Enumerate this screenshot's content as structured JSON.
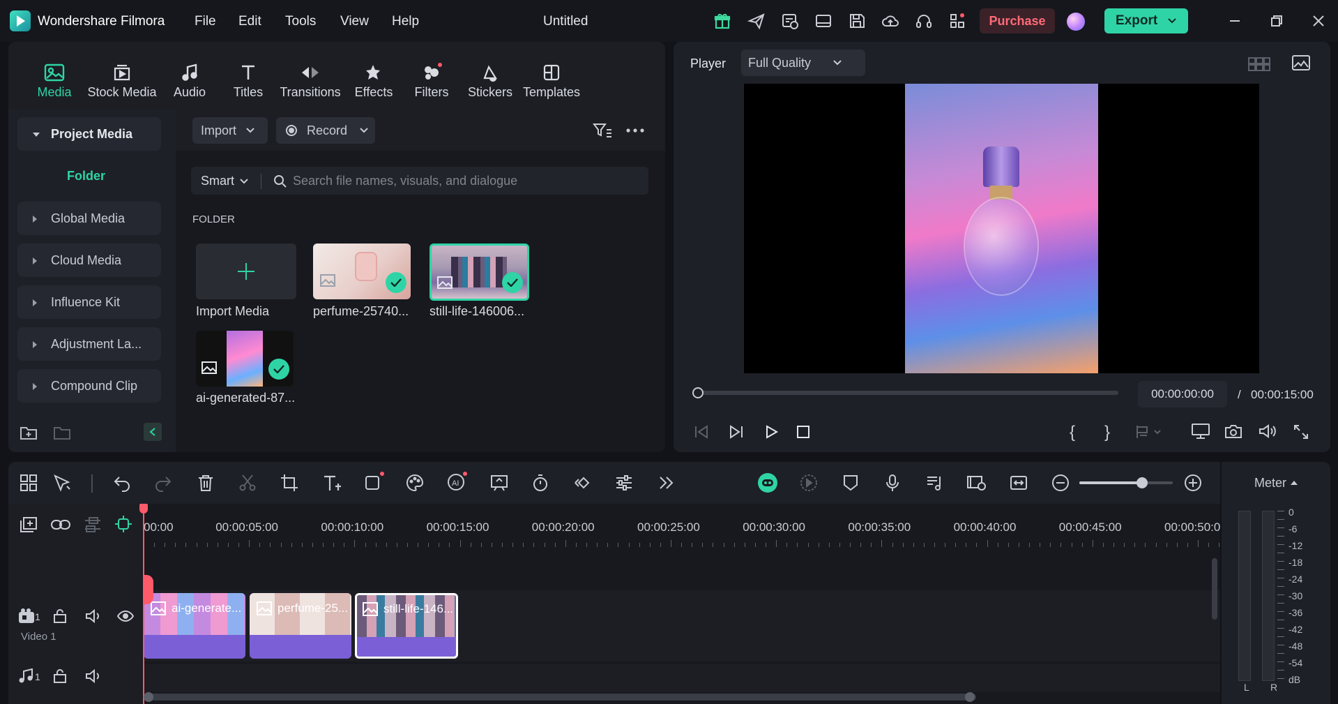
{
  "app": {
    "name": "Wondershare Filmora",
    "doc_title": "Untitled",
    "purchase": "Purchase",
    "export": "Export"
  },
  "menu": [
    "File",
    "Edit",
    "Tools",
    "View",
    "Help"
  ],
  "tabs": [
    "Media",
    "Stock Media",
    "Audio",
    "Titles",
    "Transitions",
    "Effects",
    "Filters",
    "Stickers",
    "Templates"
  ],
  "sidebar": {
    "project_media": "Project Media",
    "folder": "Folder",
    "items": [
      "Global Media",
      "Cloud Media",
      "Influence Kit",
      "Adjustment La...",
      "Compound Clip"
    ]
  },
  "media": {
    "import": "Import",
    "record": "Record",
    "smart": "Smart",
    "search_placeholder": "Search file names, visuals, and dialogue",
    "folder_label": "FOLDER",
    "items": [
      "Import Media",
      "perfume-25740...",
      "still-life-146006...",
      "ai-generated-87..."
    ]
  },
  "player": {
    "label": "Player",
    "quality": "Full Quality",
    "current_time": "00:00:00:00",
    "separator": "/",
    "total_time": "00:00:15:00",
    "progress": 0
  },
  "timeline": {
    "ruler": [
      "00:00",
      "00:00:05:00",
      "00:00:10:00",
      "00:00:15:00",
      "00:00:20:00",
      "00:00:25:00",
      "00:00:30:00",
      "00:00:35:00",
      "00:00:40:00",
      "00:00:45:00",
      "00:00:50:0"
    ],
    "clips": [
      "ai-generate...",
      "perfume-25...",
      "still-life-146..."
    ],
    "video_track_num": "1",
    "video_track_name": "Video 1",
    "audio_track_num": "1",
    "zoom_level": 0.67
  },
  "meter": {
    "label": "Meter",
    "scale": [
      "0",
      "-6",
      "-12",
      "-18",
      "-24",
      "-30",
      "-36",
      "-42",
      "-48",
      "-54",
      "dB"
    ],
    "left": "L",
    "right": "R"
  },
  "colors": {
    "accent": "#2fd4a6",
    "purchase_text": "#ff6a78",
    "purchase_bg": "#3a2228",
    "bg": "#111318",
    "panel": "#1e2027"
  }
}
